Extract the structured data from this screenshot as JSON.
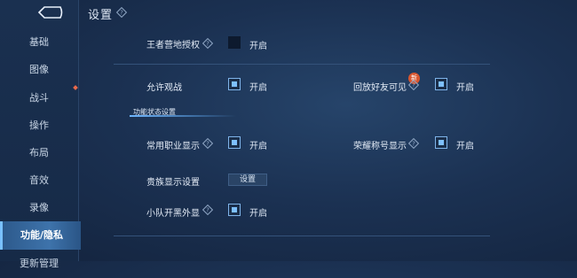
{
  "header": {
    "title": "设置"
  },
  "sidebar": {
    "items": [
      {
        "label": "基础"
      },
      {
        "label": "图像"
      },
      {
        "label": "战斗"
      },
      {
        "label": "操作"
      },
      {
        "label": "布局"
      },
      {
        "label": "音效"
      },
      {
        "label": "录像"
      },
      {
        "label": "功能/隐私"
      },
      {
        "label": "更新管理"
      }
    ],
    "active_index": 7
  },
  "settings": {
    "camp_auth": {
      "label": "王者营地授权",
      "option": "开启",
      "checked": false
    },
    "allow_spectate": {
      "label": "允许观战",
      "option": "开启",
      "checked": true
    },
    "replay_friends": {
      "label": "回放好友可见",
      "option": "开启",
      "checked": true,
      "badge": "新"
    },
    "section_title": "功能状态设置",
    "common_job": {
      "label": "常用职业显示",
      "option": "开启",
      "checked": true
    },
    "honor_title": {
      "label": "荣耀称号显示",
      "option": "开启",
      "checked": true
    },
    "noble_display": {
      "label": "贵族显示设置",
      "button": "设置"
    },
    "squad_appearance": {
      "label": "小队开黑外显",
      "option": "开启",
      "checked": true
    }
  },
  "colors": {
    "accent": "#7ec0ff",
    "active_tab": "#3e73ab",
    "badge": "#d9562f"
  }
}
